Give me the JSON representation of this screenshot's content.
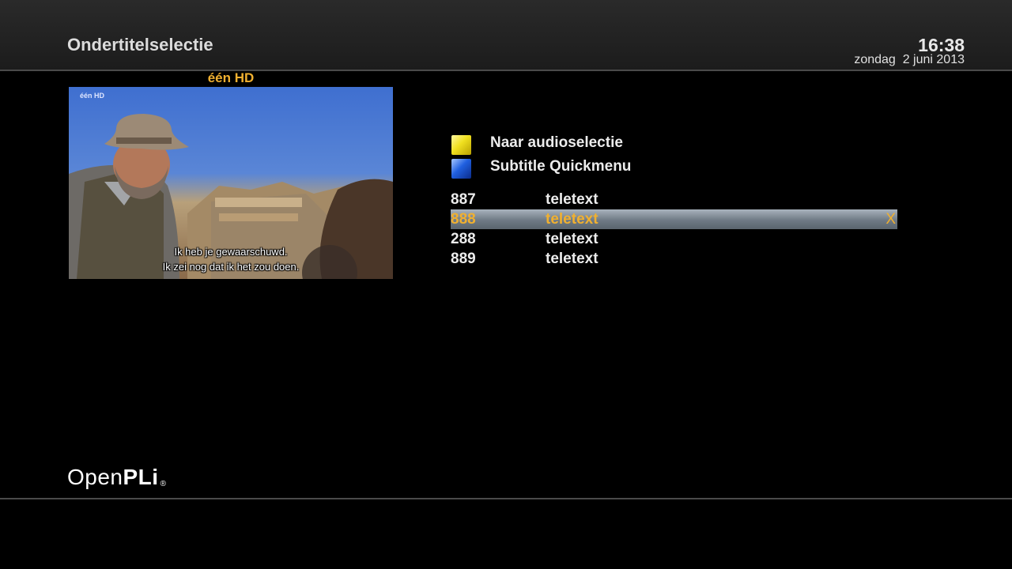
{
  "header": {
    "title": "Ondertitelselectie",
    "time": "16:38",
    "date": "zondag  2 juni 2013"
  },
  "preview": {
    "channel": "één HD",
    "channel_logo": "één HD",
    "subtitle_line1": "Ik heb je gewaarschuwd.",
    "subtitle_line2": "Ik zei nog dat ik het zou doen."
  },
  "actions": {
    "yellow_label": "Naar audioselectie",
    "blue_label": "Subtitle Quickmenu",
    "yellow_color": "#f0e020",
    "blue_color": "#2060e0"
  },
  "subtitles": [
    {
      "pid": "887",
      "type": "teletext",
      "mark": ""
    },
    {
      "pid": "888",
      "type": "teletext",
      "mark": "X"
    },
    {
      "pid": "288",
      "type": "teletext",
      "mark": ""
    },
    {
      "pid": "889",
      "type": "teletext",
      "mark": ""
    }
  ],
  "selected_index": 1,
  "accent_color": "#f0b030",
  "footer": {
    "brand_light": "Open",
    "brand_bold": "PLi",
    "brand_mark": "®"
  }
}
